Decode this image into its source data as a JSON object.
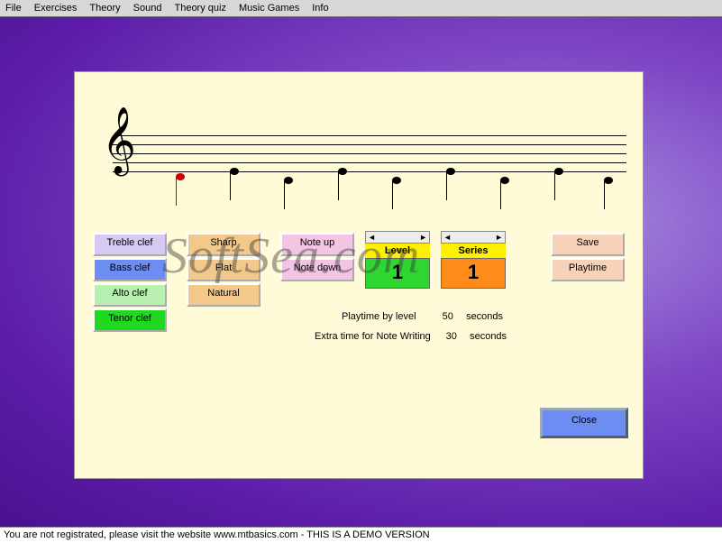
{
  "menu": {
    "items": [
      "File",
      "Exercises",
      "Theory",
      "Sound",
      "Theory quiz",
      "Music Games",
      "Info"
    ]
  },
  "buttons": {
    "treble": "Treble clef",
    "bass": "Bass clef",
    "alto": "Alto clef",
    "tenor": "Tenor clef",
    "sharp": "Sharp",
    "flat": "Flat",
    "natural": "Natural",
    "noteup": "Note up",
    "notedown": "Note down",
    "save": "Save",
    "playtime": "Playtime",
    "close": "Close"
  },
  "selectors": {
    "level": {
      "label": "Level",
      "value": "1"
    },
    "series": {
      "label": "Series",
      "value": "1"
    }
  },
  "settings": {
    "playtime_label": "Playtime by level",
    "playtime_value": "50",
    "playtime_unit": "seconds",
    "extra_label": "Extra time for Note Writing",
    "extra_value": "30",
    "extra_unit": "seconds"
  },
  "status": "You are not registrated, please visit the website www.mtbasics.com - THIS IS A DEMO VERSION",
  "watermark": "SoftSea.com",
  "colors": {
    "treble": "#d8c8f4",
    "bass": "#6d8df2",
    "alto": "#b8f0b0",
    "tenor": "#20d820",
    "sharp": "#f2c98a",
    "flat": "#f2c98a",
    "natural": "#f2c98a",
    "noteup": "#f4c4e4",
    "notedown": "#f4c4e4",
    "save": "#f8d2b8",
    "playtime": "#f8d2b8"
  },
  "arrows": {
    "left": "◄",
    "right": "►"
  }
}
